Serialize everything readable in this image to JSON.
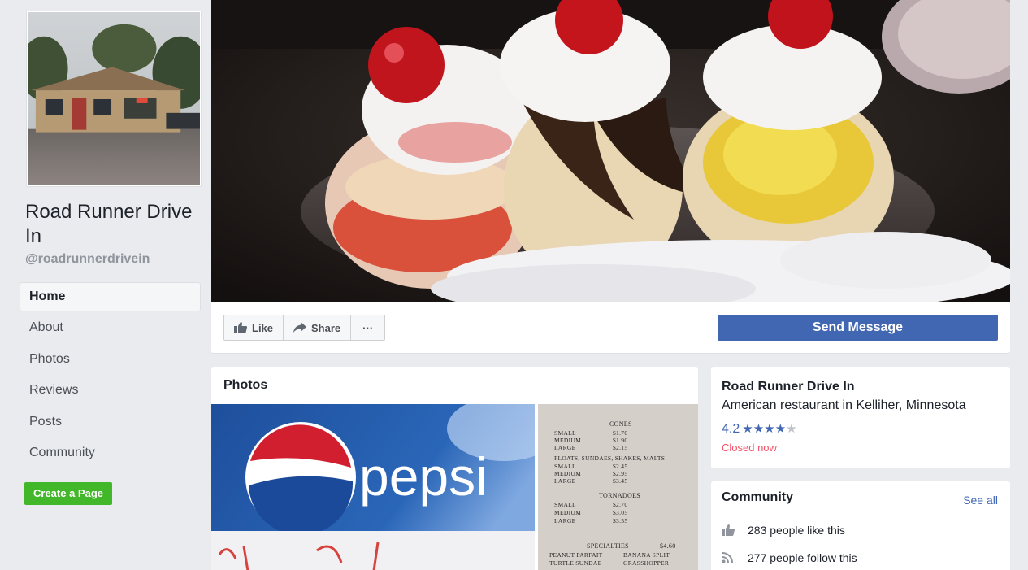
{
  "page": {
    "name": "Road Runner Drive In",
    "handle": "@roadrunnerdrivein"
  },
  "nav": {
    "items": [
      {
        "label": "Home",
        "active": true
      },
      {
        "label": "About"
      },
      {
        "label": "Photos"
      },
      {
        "label": "Reviews"
      },
      {
        "label": "Posts"
      },
      {
        "label": "Community"
      }
    ],
    "create_page": "Create a Page"
  },
  "actions": {
    "like": "Like",
    "share": "Share",
    "more": "···",
    "send_message": "Send Message"
  },
  "photos": {
    "title": "Photos",
    "pepsi_brand": "pepsi",
    "menu": {
      "cones": "CONES",
      "cone_rows": [
        [
          "SMALL",
          "$1.70"
        ],
        [
          "MEDIUM",
          "$1.90"
        ],
        [
          "LARGE",
          "$2.15"
        ]
      ],
      "floats": "FLOATS, SUNDAES, SHAKES, MALTS",
      "float_rows": [
        [
          "SMALL",
          "$2.45"
        ],
        [
          "MEDIUM",
          "$2.95"
        ],
        [
          "LARGE",
          "$3.45"
        ]
      ],
      "tornadoes": "TORNADOES",
      "tornado_rows": [
        [
          "SMALL",
          "$2.70"
        ],
        [
          "MEDIUM",
          "$3.05"
        ],
        [
          "LARGE",
          "$3.55"
        ]
      ],
      "specialties": "SPECIALTIES",
      "specialties_price": "$4.60",
      "special_rows": [
        [
          "PEANUT PARFAIT",
          "BANANA SPLIT"
        ],
        [
          "TURTLE SUNDAE",
          "GRASSHOPPER"
        ]
      ]
    }
  },
  "info": {
    "name": "Road Runner Drive In",
    "category": "American restaurant in Kelliher, Minnesota",
    "rating": "4.2",
    "rating_fraction": 0.84,
    "status": "Closed now"
  },
  "community": {
    "title": "Community",
    "see_all": "See all",
    "likes": "283 people like this",
    "follows": "277 people follow this"
  },
  "colors": {
    "background": "#e9ebee",
    "brand_blue": "#4267b2",
    "green": "#42b72a",
    "closed_red": "#f35369"
  }
}
